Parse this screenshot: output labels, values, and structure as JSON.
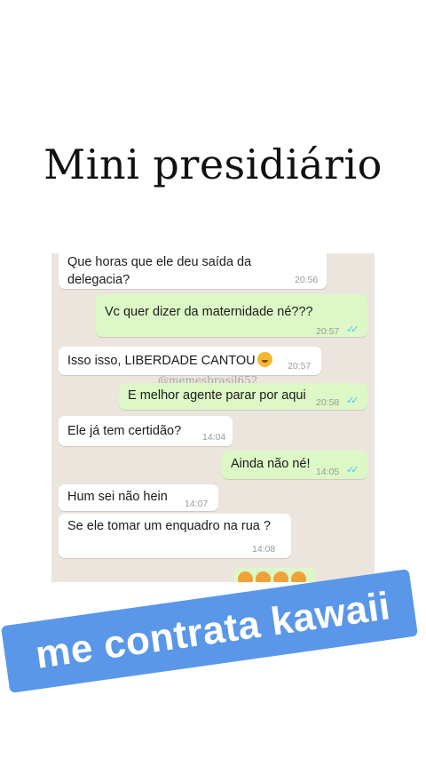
{
  "title": "Mini presidiário",
  "watermark": "@memesbrasil652",
  "messages": [
    {
      "text": "Que horas que ele deu saída da delegacia?",
      "time": "20:56"
    },
    {
      "text": "Vc quer dizer da maternidade né???",
      "time": "20:57"
    },
    {
      "text": "Isso isso, LIBERDADE CANTOU",
      "time": "20:57"
    },
    {
      "text": "E melhor agente parar por aqui",
      "time": "20:58"
    },
    {
      "text": "Ele já tem certidão?",
      "time": "14:04"
    },
    {
      "text": "Ainda não né!",
      "time": "14:05"
    },
    {
      "text": "Hum sei não hein",
      "time": "14:07"
    },
    {
      "text": "Se ele tomar um enquadro na rua ?",
      "time": "14:08"
    }
  ],
  "banner": "me contrata kawaii",
  "colors": {
    "incoming": "#ffffff",
    "outgoing": "#dcf8c6",
    "chat_bg": "#ece5dd",
    "banner": "#5b97e8"
  }
}
